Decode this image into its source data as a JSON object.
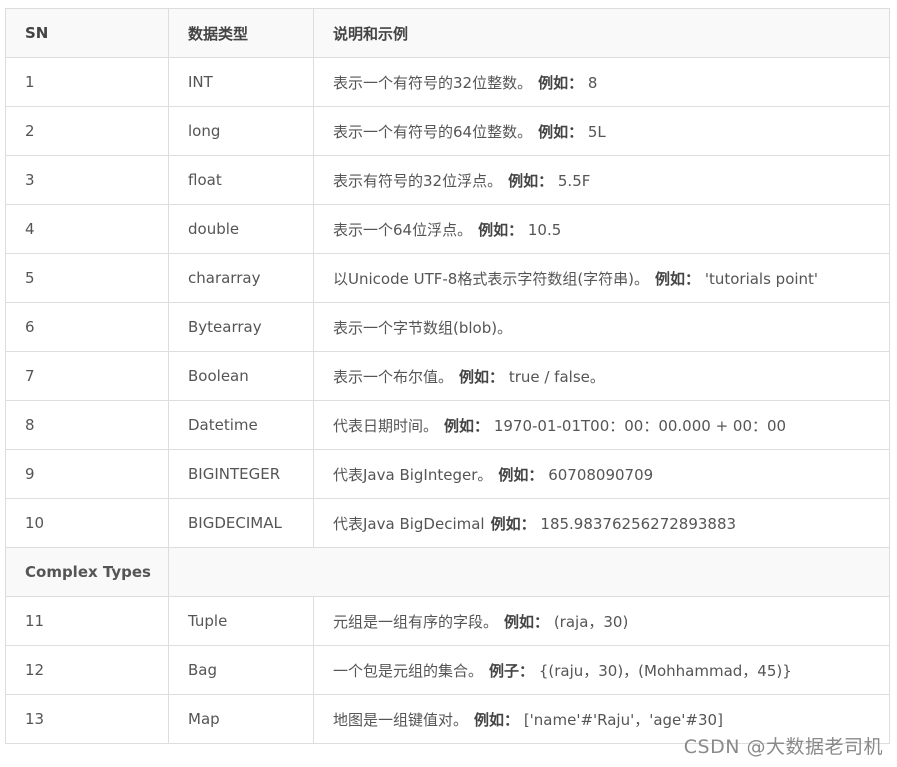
{
  "table": {
    "headers": [
      "SN",
      "数据类型",
      "说明和示例"
    ],
    "rows": [
      {
        "sn": "1",
        "type": "INT",
        "desc": "表示一个有符号的32位整数。",
        "label": "例如：",
        "example": "8"
      },
      {
        "sn": "2",
        "type": "long",
        "desc": "表示一个有符号的64位整数。",
        "label": "例如：",
        "example": "5L"
      },
      {
        "sn": "3",
        "type": "float",
        "desc": "表示有符号的32位浮点。",
        "label": "例如：",
        "example": "5.5F"
      },
      {
        "sn": "4",
        "type": "double",
        "desc": "表示一个64位浮点。",
        "label": "例如：",
        "example": "10.5"
      },
      {
        "sn": "5",
        "type": "chararray",
        "desc": "以Unicode UTF-8格式表示字符数组(字符串)。",
        "label": "例如：",
        "example": "'tutorials point'"
      },
      {
        "sn": "6",
        "type": "Bytearray",
        "desc": "表示一个字节数组(blob)。",
        "label": "",
        "example": ""
      },
      {
        "sn": "7",
        "type": "Boolean",
        "desc": "表示一个布尔值。",
        "label": "例如：",
        "example": "true / false。"
      },
      {
        "sn": "8",
        "type": "Datetime",
        "desc": "代表日期时间。",
        "label": "例如：",
        "example": "1970-01-01T00：00：00.000 + 00：00"
      },
      {
        "sn": "9",
        "type": "BIGINTEGER",
        "desc": "代表Java BigInteger。",
        "label": "例如：",
        "example": "60708090709"
      },
      {
        "sn": "10",
        "type": "BIGDECIMAL",
        "desc": "代表Java BigDecimal",
        "label": "例如：",
        "example": "185.98376256272893883"
      }
    ],
    "section_label": "Complex Types",
    "complex_rows": [
      {
        "sn": "11",
        "type": "Tuple",
        "desc": "元组是一组有序的字段。",
        "label": "例如：",
        "example": "(raja，30)"
      },
      {
        "sn": "12",
        "type": "Bag",
        "desc": "一个包是元组的集合。",
        "label": "例子：",
        "example": "{(raju，30)，(Mohhammad，45)}"
      },
      {
        "sn": "13",
        "type": "Map",
        "desc": "地图是一组键值对。",
        "label": "例如：",
        "example": "['name'#'Raju'，'age'#30]"
      }
    ]
  },
  "watermark": "CSDN @大数据老司机"
}
